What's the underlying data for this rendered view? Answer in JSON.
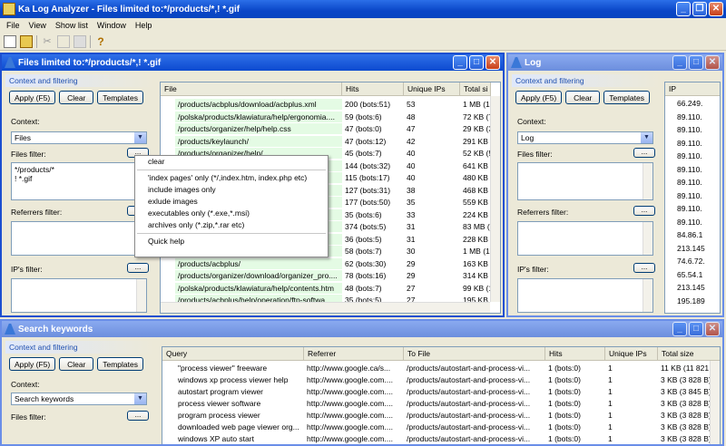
{
  "app": {
    "title": "Ka Log Analyzer - Files limited to:*/products/*,! *.gif"
  },
  "menu": [
    "File",
    "View",
    "Show list",
    "Window",
    "Help"
  ],
  "files_window": {
    "title": "Files limited to:*/products/*,! *.gif",
    "section": "Context and filtering",
    "apply": "Apply (F5)",
    "clear": "Clear",
    "templates": "Templates",
    "context_label": "Context:",
    "context_value": "Files",
    "files_filter_label": "Files filter:",
    "files_filter_value": [
      "*/products/*",
      "! *.gif"
    ],
    "referrers_label": "Referrers filter:",
    "ips_label": "IP's filter:",
    "more": "...",
    "columns": [
      "File",
      "Hits",
      "Unique IPs",
      "Total si"
    ],
    "rows": [
      [
        "/products/acbplus/download/acbplus.xml",
        "200  (bots:51)",
        "53",
        "1 MB (1"
      ],
      [
        "/polska/products/klawiatura/help/ergonomia....",
        "59  (bots:6)",
        "48",
        "72 KB (7"
      ],
      [
        "/products/organizer/help/help.css",
        "47  (bots:0)",
        "47",
        "29 KB (3"
      ],
      [
        "/products/keylaunch/",
        "47  (bots:12)",
        "42",
        "291 KB ("
      ],
      [
        "/products/organizer/help/",
        "45  (bots:7)",
        "40",
        "52 KB (5"
      ],
      [
        "",
        "144  (bots:32)",
        "40",
        "641 KB ("
      ],
      [
        "",
        "115  (bots:17)",
        "40",
        "480 KB ("
      ],
      [
        "",
        "127  (bots:31)",
        "38",
        "468 KB ("
      ],
      [
        "",
        "177  (bots:50)",
        "35",
        "559 KB ("
      ],
      [
        "",
        "35  (bots:6)",
        "33",
        "224 KB ("
      ],
      [
        "",
        "374  (bots:5)",
        "31",
        "83 MB ("
      ],
      [
        "",
        "36  (bots:5)",
        "31",
        "228 KB ("
      ],
      [
        "",
        "58  (bots:7)",
        "30",
        "1 MB (1"
      ],
      [
        "/products/acbplus/",
        "62  (bots:30)",
        "29",
        "163 KB ("
      ],
      [
        "/products/organizer/download/organizer_pro....",
        "78  (bots:16)",
        "29",
        "314 KB ("
      ],
      [
        "/polska/products/klawiatura/help/contents.htm",
        "48  (bots:7)",
        "27",
        "99 KB (1"
      ],
      [
        "/products/acbplus/help/operation/ftp-softwa....",
        "35  (bots:5)",
        "27",
        "195 KB ("
      ]
    ]
  },
  "context_menu": {
    "items": [
      "clear",
      "'index pages' only (*/,index.htm, index.php etc)",
      "include images only",
      "exlude images",
      "executables only (*.exe,*.msi)",
      "archives only (*.zip,*.rar etc)",
      "Quick help"
    ]
  },
  "log_window": {
    "title": "Log",
    "section": "Context and filtering",
    "apply": "Apply (F5)",
    "clear": "Clear",
    "templates": "Templates",
    "context_label": "Context:",
    "context_value": "Log",
    "files_filter_label": "Files filter:",
    "referrers_label": "Referrers filter:",
    "ips_label": "IP's filter:",
    "more": "...",
    "column": "IP",
    "ips": [
      "66.249.",
      "89.110.",
      "89.110.",
      "89.110.",
      "89.110.",
      "89.110.",
      "89.110.",
      "89.110.",
      "89.110.",
      "89.110.",
      "84.86.1",
      "213.145",
      "74.6.72.",
      "65.54.1",
      "213.145",
      "195.189"
    ]
  },
  "search_window": {
    "title": "Search keywords",
    "section": "Context and filtering",
    "apply": "Apply (F5)",
    "clear": "Clear",
    "templates": "Templates",
    "context_label": "Context:",
    "context_value": "Search keywords",
    "files_filter_label": "Files filter:",
    "more": "...",
    "columns": [
      "Query",
      "Referrer",
      "To File",
      "Hits",
      "Unique IPs",
      "Total size"
    ],
    "rows": [
      [
        "\"process viewer\" freeware",
        "http://www.google.ca/s...",
        "/products/autostart-and-process-vi...",
        "1  (bots:0)",
        "1",
        "11 KB (11 821"
      ],
      [
        "windows xp process viewer help",
        "http://www.google.com....",
        "/products/autostart-and-process-vi...",
        "1  (bots:0)",
        "1",
        "3 KB (3 828 B)"
      ],
      [
        "autostart program viewer",
        "http://www.google.com....",
        "/products/autostart-and-process-vi...",
        "1  (bots:0)",
        "1",
        "3 KB (3 845 B)"
      ],
      [
        "process viewer software",
        "http://www.google.com....",
        "/products/autostart-and-process-vi...",
        "1  (bots:0)",
        "1",
        "3 KB (3 828 B)"
      ],
      [
        "program process viewer",
        "http://www.google.com....",
        "/products/autostart-and-process-vi...",
        "1  (bots:0)",
        "1",
        "3 KB (3 828 B)"
      ],
      [
        "downloaded web page viewer org...",
        "http://www.google.com....",
        "/products/autostart-and-process-vi...",
        "1  (bots:0)",
        "1",
        "3 KB (3 828 B)"
      ],
      [
        "windows XP auto start",
        "http://www.google.com....",
        "/products/autostart-and-process-vi...",
        "1  (bots:0)",
        "1",
        "3 KB (3 828 B)"
      ]
    ]
  }
}
